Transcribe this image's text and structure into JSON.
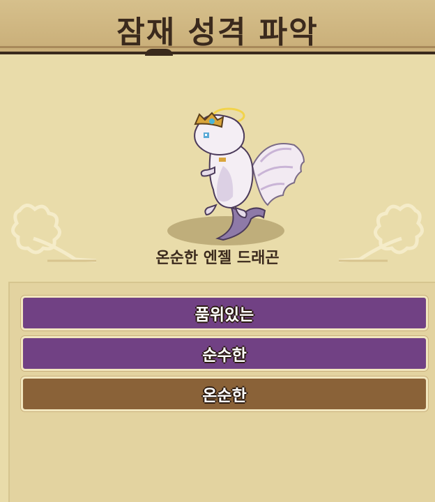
{
  "header": {
    "title": "잠재 성격 파악"
  },
  "creature": {
    "name": "온순한 엔젤 드래곤",
    "icon": "angel-dragon-sprite"
  },
  "options": [
    {
      "label": "품위있는",
      "color": "#714184",
      "state": "available"
    },
    {
      "label": "순수한",
      "color": "#714184",
      "state": "available"
    },
    {
      "label": "온순한",
      "color": "#8a6238",
      "state": "selected"
    }
  ]
}
